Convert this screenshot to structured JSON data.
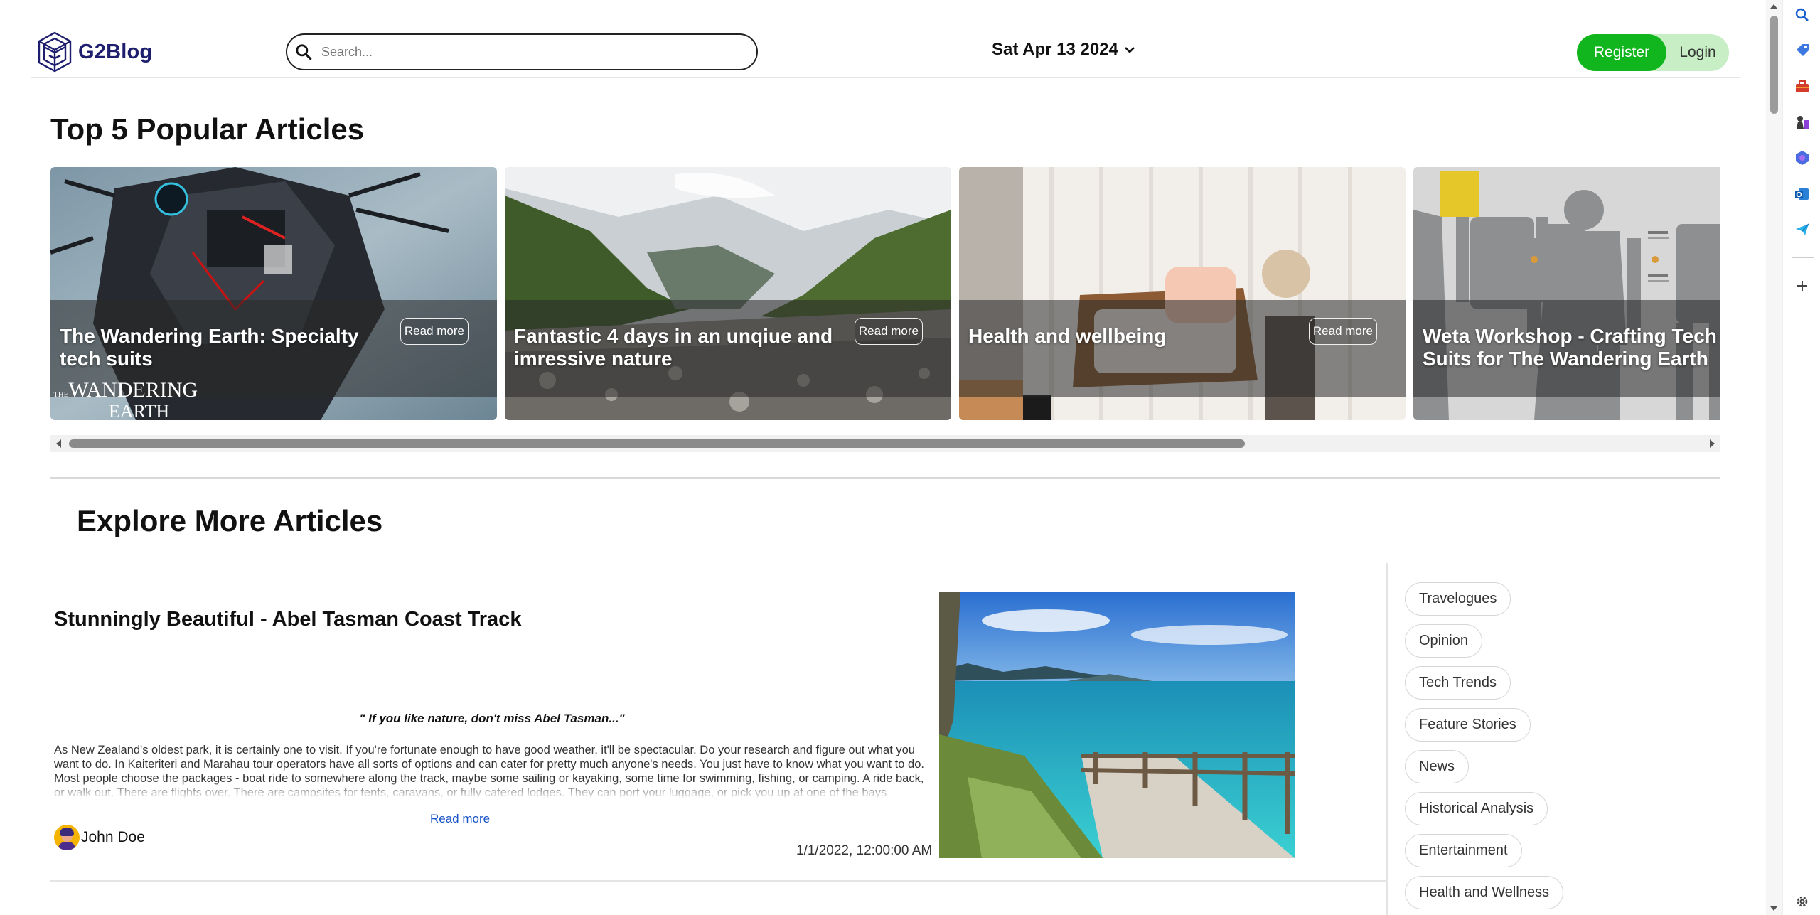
{
  "header": {
    "brand": "G2Blog",
    "search_placeholder": "Search...",
    "date": "Sat Apr 13 2024",
    "register_label": "Register",
    "login_label": "Login"
  },
  "popular": {
    "title": "Top 5 Popular Articles",
    "cards": [
      {
        "title": "The Wandering Earth: Specialty tech suits",
        "read_more": "Read more",
        "logo_text_top": "THE",
        "logo_text_big": "WANDERING",
        "logo_text_sub": "EARTH"
      },
      {
        "title": "Fantastic 4 days in an unqiue and imressive nature",
        "read_more": "Read more"
      },
      {
        "title": "Health and wellbeing",
        "read_more": "Read more"
      },
      {
        "title": "Weta Workshop - Crafting Tech Suits for The Wandering Earth",
        "read_more": "Read more"
      }
    ],
    "scroll_position": 0.72
  },
  "explore": {
    "title": "Explore More Articles",
    "article": {
      "title": "Stunningly Beautiful - Abel Tasman Coast Track",
      "quote": "\" If you like nature, don't miss Abel Tasman...\"",
      "body": "As New Zealand's oldest park, it is certainly one to visit. If you're fortunate enough to have good weather, it'll be spectacular. Do your research and figure out what you want to do. In Kaiteriteri and Marahau tour operators have all sorts of options and can cater for pretty much anyone's needs. You just have to know what you want to do. Most people choose the packages - boat ride to somewhere along the track, maybe some sailing or kayaking, some time for swimming, fishing, or camping. A ride back, or walk out. There are flights over. There are campsites for tents, caravans, or fully catered lodges. They can port your luggage, or pick you up at one of the bays",
      "read_more": "Read more",
      "author": "John Doe",
      "date": "1/1/2022, 12:00:00 AM"
    }
  },
  "categories": [
    "Travelogues",
    "Opinion",
    "Tech Trends",
    "Feature Stories",
    "News",
    "Historical Analysis",
    "Entertainment",
    "Health and Wellness"
  ],
  "colors": {
    "brand": "#1e1e6e",
    "register": "#11b51d",
    "login_bg": "#c7eec4",
    "link": "#1a55c8"
  },
  "rail_icons": [
    "search-icon",
    "tag-icon",
    "briefcase-icon",
    "chess-icon",
    "copilot-icon",
    "outlook-icon",
    "send-icon",
    "plus-icon",
    "gear-icon"
  ]
}
